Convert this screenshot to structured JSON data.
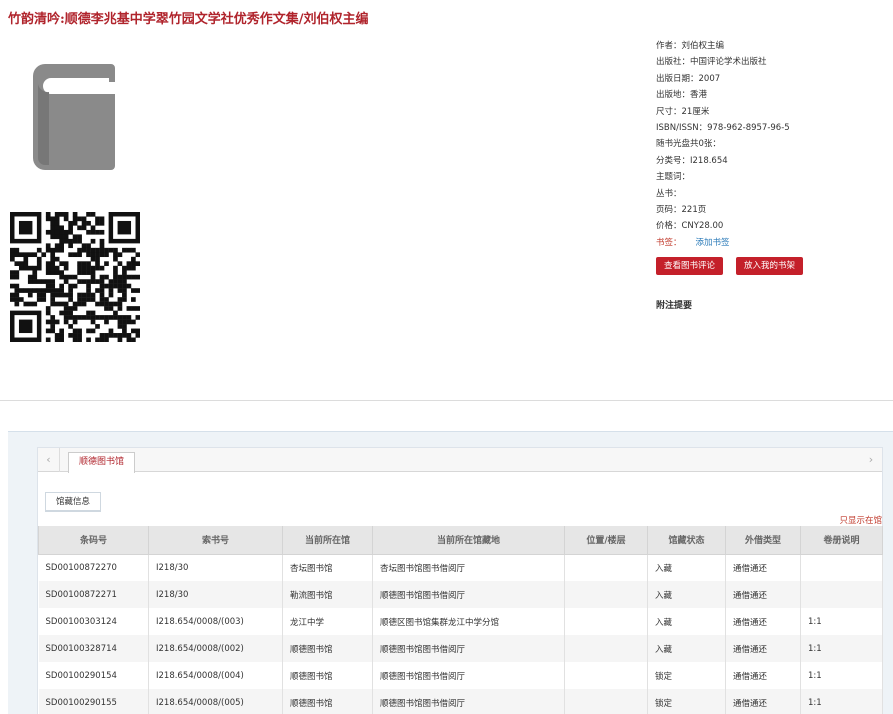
{
  "title": "竹韵清吟:顺德李兆基中学翠竹园文学社优秀作文集/刘伯权主编",
  "meta": {
    "author": "作者：刘伯权主编",
    "publisher": "出版社：中国评论学术出版社",
    "pub_date": "出版日期：2007",
    "pub_place": "出版地：香港",
    "size": "尺寸：21厘米",
    "isbn": "ISBN/ISSN：978-962-8957-96-5",
    "disc": "随书光盘共0张：",
    "class_no": "分类号：I218.654",
    "subject": "主题词：",
    "series": "丛书：",
    "pages": "页码：221页",
    "price": "价格：CNY28.00",
    "tags_label": "书签：",
    "add_tag": "添加书签"
  },
  "buttons": {
    "review": "查看图书评论",
    "shelf": "放入我的书架"
  },
  "notes_heading": "附注提要",
  "tabs": {
    "prev": "‹",
    "next": "›",
    "active": "顺德图书馆"
  },
  "subtab": "馆藏信息",
  "only_instock": "只显示在馆",
  "table": {
    "headers": [
      "条码号",
      "索书号",
      "当前所在馆",
      "当前所在馆藏地",
      "位置/楼层",
      "馆藏状态",
      "外借类型",
      "卷册说明"
    ],
    "rows": [
      [
        "SD00100872270",
        "I218/30",
        "杏坛图书馆",
        "杏坛图书馆图书借阅厅",
        "",
        "入藏",
        "通借通还",
        ""
      ],
      [
        "SD00100872271",
        "I218/30",
        "勒流图书馆",
        "顺德图书馆图书借阅厅",
        "",
        "入藏",
        "通借通还",
        ""
      ],
      [
        "SD00100303124",
        "I218.654/0008/(003)",
        "龙江中学",
        "顺德区图书馆集群龙江中学分馆",
        "",
        "入藏",
        "通借通还",
        "1:1"
      ],
      [
        "SD00100328714",
        "I218.654/0008/(002)",
        "顺德图书馆",
        "顺德图书馆图书借阅厅",
        "",
        "入藏",
        "通借通还",
        "1:1"
      ],
      [
        "SD00100290154",
        "I218.654/0008/(004)",
        "顺德图书馆",
        "顺德图书馆图书借阅厅",
        "",
        "锁定",
        "通借通还",
        "1:1"
      ],
      [
        "SD00100290155",
        "I218.654/0008/(005)",
        "顺德图书馆",
        "顺德图书馆图书借阅厅",
        "",
        "锁定",
        "通借通还",
        "1:1"
      ]
    ]
  }
}
